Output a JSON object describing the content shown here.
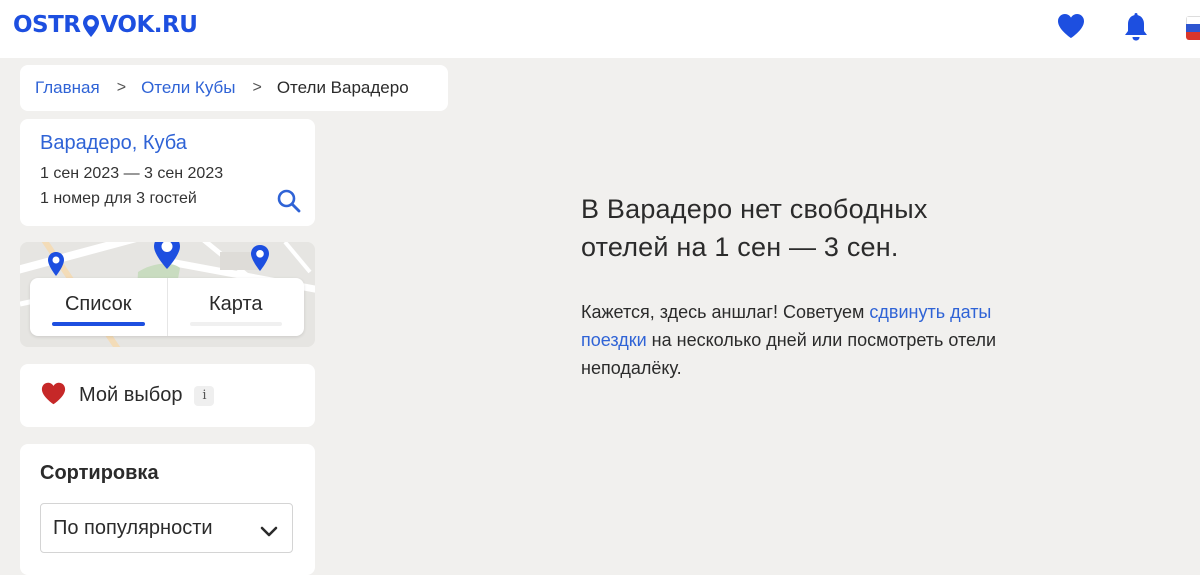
{
  "header": {
    "logo_left": "OSTR",
    "logo_right": "VOK.RU",
    "brand_color": "#1d4fe0",
    "icons": [
      "heart-icon",
      "bell-icon",
      "russian-flag-icon"
    ]
  },
  "breadcrumb": {
    "items": [
      {
        "label": "Главная"
      },
      {
        "label": "Отели Кубы"
      },
      {
        "label": "Отели Варадеро"
      }
    ],
    "separator": ">"
  },
  "search": {
    "destination": "Варадеро, Куба",
    "dates": "1 сен 2023 — 3 сен 2023",
    "guests": "1 номер для 3 гостей",
    "icon": "search-icon"
  },
  "view_toggle": {
    "list_label": "Список",
    "map_label": "Карта",
    "active": "list"
  },
  "favorites": {
    "label": "Мой выбор",
    "info": "i",
    "heart_color": "#c62828"
  },
  "sort": {
    "title": "Сортировка",
    "selected": "По популярности"
  },
  "empty_state": {
    "title": "В Варадеро нет свободных отелей на 1 сен — 3 сен.",
    "text_before": "Кажется, здесь аншлаг! Советуем ",
    "link_text": "сдвинуть даты поездки",
    "text_after": " на несколько дней или посмотреть отели неподалёку."
  }
}
